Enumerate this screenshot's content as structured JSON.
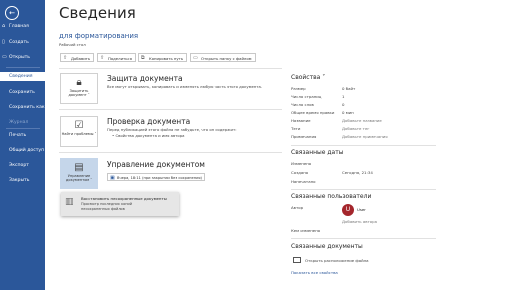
{
  "sidebar": {
    "back_icon": "arrow-left-icon",
    "items": [
      {
        "label": "Главная",
        "icon": "home-icon"
      },
      {
        "label": "Создать",
        "icon": "new-doc-icon"
      },
      {
        "label": "Открыть",
        "icon": "folder-icon"
      },
      {
        "label": "Сведения",
        "active": true
      },
      {
        "label": "Сохранить"
      },
      {
        "label": "Сохранить как"
      },
      {
        "label": "Журнал",
        "disabled": true
      },
      {
        "label": "Печать"
      },
      {
        "label": "Общий доступ"
      },
      {
        "label": "Экспорт"
      },
      {
        "label": "Закрыть"
      }
    ]
  },
  "page_title": "Сведения",
  "document": {
    "name": "для форматирования",
    "location": "Рабочий стол"
  },
  "actions": {
    "add": "Добавить",
    "share": "Поделиться",
    "copy_path": "Копировать путь",
    "open_folder": "Открыть папку с файлом"
  },
  "protect": {
    "tile_label": "Защитить документ ˅",
    "heading": "Защита документа",
    "text": "Все могут открывать, копировать и изменять любую часть этого документа."
  },
  "inspect": {
    "tile_label": "Найти проблемы ˅",
    "heading": "Проверка документа",
    "text1": "Перед публикацией этого файла не забудьте, что он содержит:",
    "bullet": "Свойства документа и имя автора"
  },
  "manage": {
    "tile_label": "Управление документом ˅",
    "heading": "Управление документом",
    "version": "Вчера, 18:11 (при закрытии без сохранения)"
  },
  "dropdown": {
    "title": "Восстановить несохраненные документы",
    "line1": "Просмотр последних копий",
    "line2": "несохраненных файлов"
  },
  "properties": {
    "heading": "Свойства ˅",
    "rows": [
      {
        "label": "Размер",
        "value": "0 байт"
      },
      {
        "label": "Число страниц",
        "value": "1"
      },
      {
        "label": "Число слов",
        "value": "0"
      },
      {
        "label": "Общее время правки",
        "value": "0 мин"
      },
      {
        "label": "Название",
        "value": "Добавьте название"
      },
      {
        "label": "Теги",
        "value": "Добавьте тег"
      },
      {
        "label": "Примечания",
        "value": "Добавьте примечания"
      }
    ]
  },
  "dates": {
    "heading": "Связанные даты",
    "rows": [
      {
        "label": "Изменено",
        "value": ""
      },
      {
        "label": "Создано",
        "value": "Сегодня, 21:34"
      },
      {
        "label": "Напечатано",
        "value": ""
      }
    ]
  },
  "people": {
    "heading": "Связанные пользователи",
    "author_label": "Автор",
    "avatar_letter": "U",
    "author_name": "User",
    "add_author": "Добавить автора",
    "last_modified_label": "Кем изменено"
  },
  "related_docs": {
    "heading": "Связанные документы",
    "open_location": "Открыть расположение файла"
  },
  "show_all": "Показать все свойства",
  "colors": {
    "accent": "#2b579a",
    "selected_tile": "#c5d6ea",
    "avatar": "#a4262c"
  }
}
